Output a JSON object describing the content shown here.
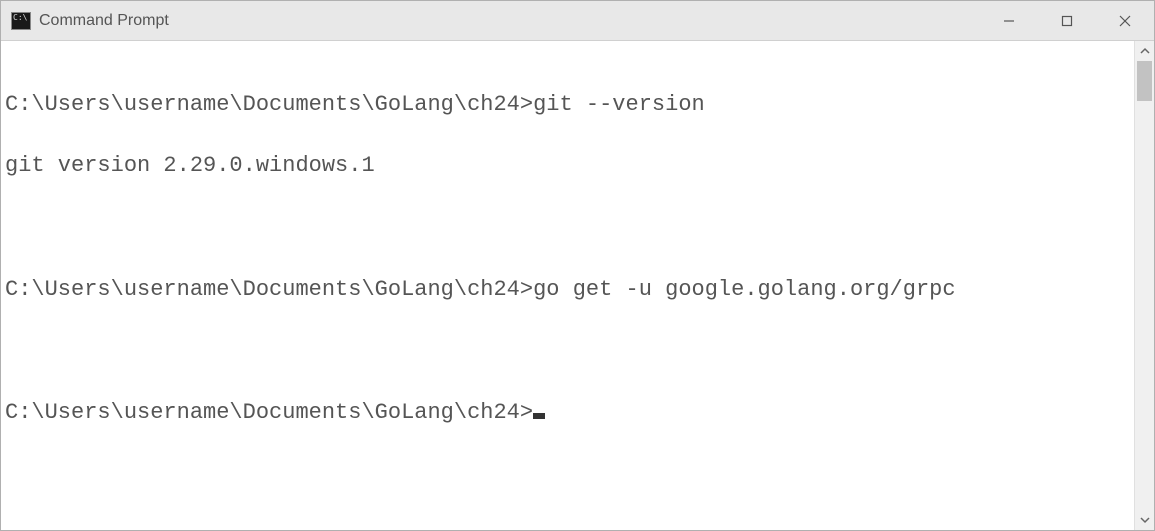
{
  "window": {
    "title": "Command Prompt"
  },
  "terminal": {
    "lines": {
      "prompt1": "C:\\Users\\username\\Documents\\GoLang\\ch24>",
      "cmd1": "git --version",
      "output1": "git version 2.29.0.windows.1",
      "blank1": "",
      "prompt2": "C:\\Users\\username\\Documents\\GoLang\\ch24>",
      "cmd2": "go get -u google.golang.org/grpc",
      "blank2": "",
      "prompt3": "C:\\Users\\username\\Documents\\GoLang\\ch24>"
    }
  }
}
